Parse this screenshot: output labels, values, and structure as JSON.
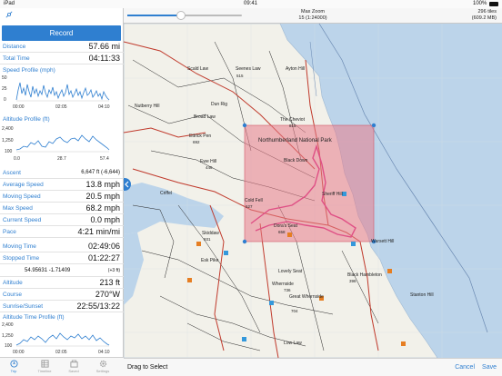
{
  "status": {
    "device": "iPad",
    "time": "09:41",
    "battery": "100%"
  },
  "topbar": {
    "zoom_label": "Max Zoom",
    "zoom_value": "15 (1:24000)",
    "tiles_count": "296 tiles",
    "tiles_size": "(609.2 MB)"
  },
  "sidebar": {
    "record_label": "Record",
    "distance_label": "Distance",
    "distance_value": "57.66 mi",
    "total_time_label": "Total Time",
    "total_time_value": "04:11:33",
    "speed_profile_title": "Speed Profile (mph)",
    "speed_profile_y_ticks": [
      "50",
      "25",
      "0"
    ],
    "speed_profile_x_ticks": [
      "00:00",
      "02:05",
      "04:10"
    ],
    "altitude_profile_title": "Altitude Profile (ft)",
    "altitude_profile_y_ticks": [
      "2,400",
      "1,250",
      "100"
    ],
    "altitude_profile_x_ticks": [
      "0.0",
      "28.7",
      "57.4"
    ],
    "ascent_label": "Ascent",
    "ascent_value": "6,647 ft (-6,644)",
    "avg_speed_label": "Average Speed",
    "avg_speed_value": "13.8 mph",
    "moving_speed_label": "Moving Speed",
    "moving_speed_value": "20.5 mph",
    "max_speed_label": "Max Speed",
    "max_speed_value": "68.2 mph",
    "current_speed_label": "Current Speed",
    "current_speed_value": "0.0 mph",
    "pace_label": "Pace",
    "pace_value": "4:21 min/mi",
    "moving_time_label": "Moving Time",
    "moving_time_value": "02:49:06",
    "stopped_time_label": "Stopped Time",
    "stopped_time_value": "01:22:27",
    "coords_value": "54.95631 -1.71409",
    "coords_accuracy": "(+3 ft)",
    "altitude_label": "Altitude",
    "altitude_value": "213 ft",
    "course_label": "Course",
    "course_value": "270°W",
    "sunrise_label": "Sunrise/Sunset",
    "sunrise_value": "22:55/13:22",
    "alt_time_title": "Altitude Time Profile (ft)",
    "alt_time_y_ticks": [
      "2,400",
      "1,250",
      "100"
    ],
    "alt_time_x_ticks": [
      "00:00",
      "02:05",
      "04:10"
    ]
  },
  "tabs": [
    {
      "label": "Trip",
      "icon": "trip-icon"
    },
    {
      "label": "Timeline",
      "icon": "timeline-icon"
    },
    {
      "label": "Saved",
      "icon": "saved-icon"
    },
    {
      "label": "Settings",
      "icon": "settings-icon"
    }
  ],
  "map_labels": [
    "Scald Law",
    "Seenes Law",
    "Ayton Hill",
    "Dun Rig",
    "Broad Law",
    "Ettrick Pen",
    "The Cheviot",
    "Northumberland National Park",
    "Black Down",
    "Cold Fell",
    "Sheriff Hill",
    "Dora's Seat",
    "Warsett Hill",
    "Skiddaw",
    "Lovely Seat",
    "Whernside",
    "Black Hambleton",
    "Great Whernside",
    "Stanton Hill",
    "Nutberry Hill",
    "Ewe Hill",
    "Criffel",
    "Esk Pike",
    "Low Law"
  ],
  "map_numbers": [
    "515",
    "692",
    "446",
    "815",
    "627",
    "658",
    "931",
    "736",
    "704",
    "398"
  ],
  "bottombar": {
    "hint": "Drag to Select",
    "cancel": "Cancel",
    "save": "Save"
  },
  "colors": {
    "accent": "#2f7fd0",
    "selection": "#e87c8a",
    "land": "#f2f1ea",
    "sea": "#bcd4ea"
  }
}
